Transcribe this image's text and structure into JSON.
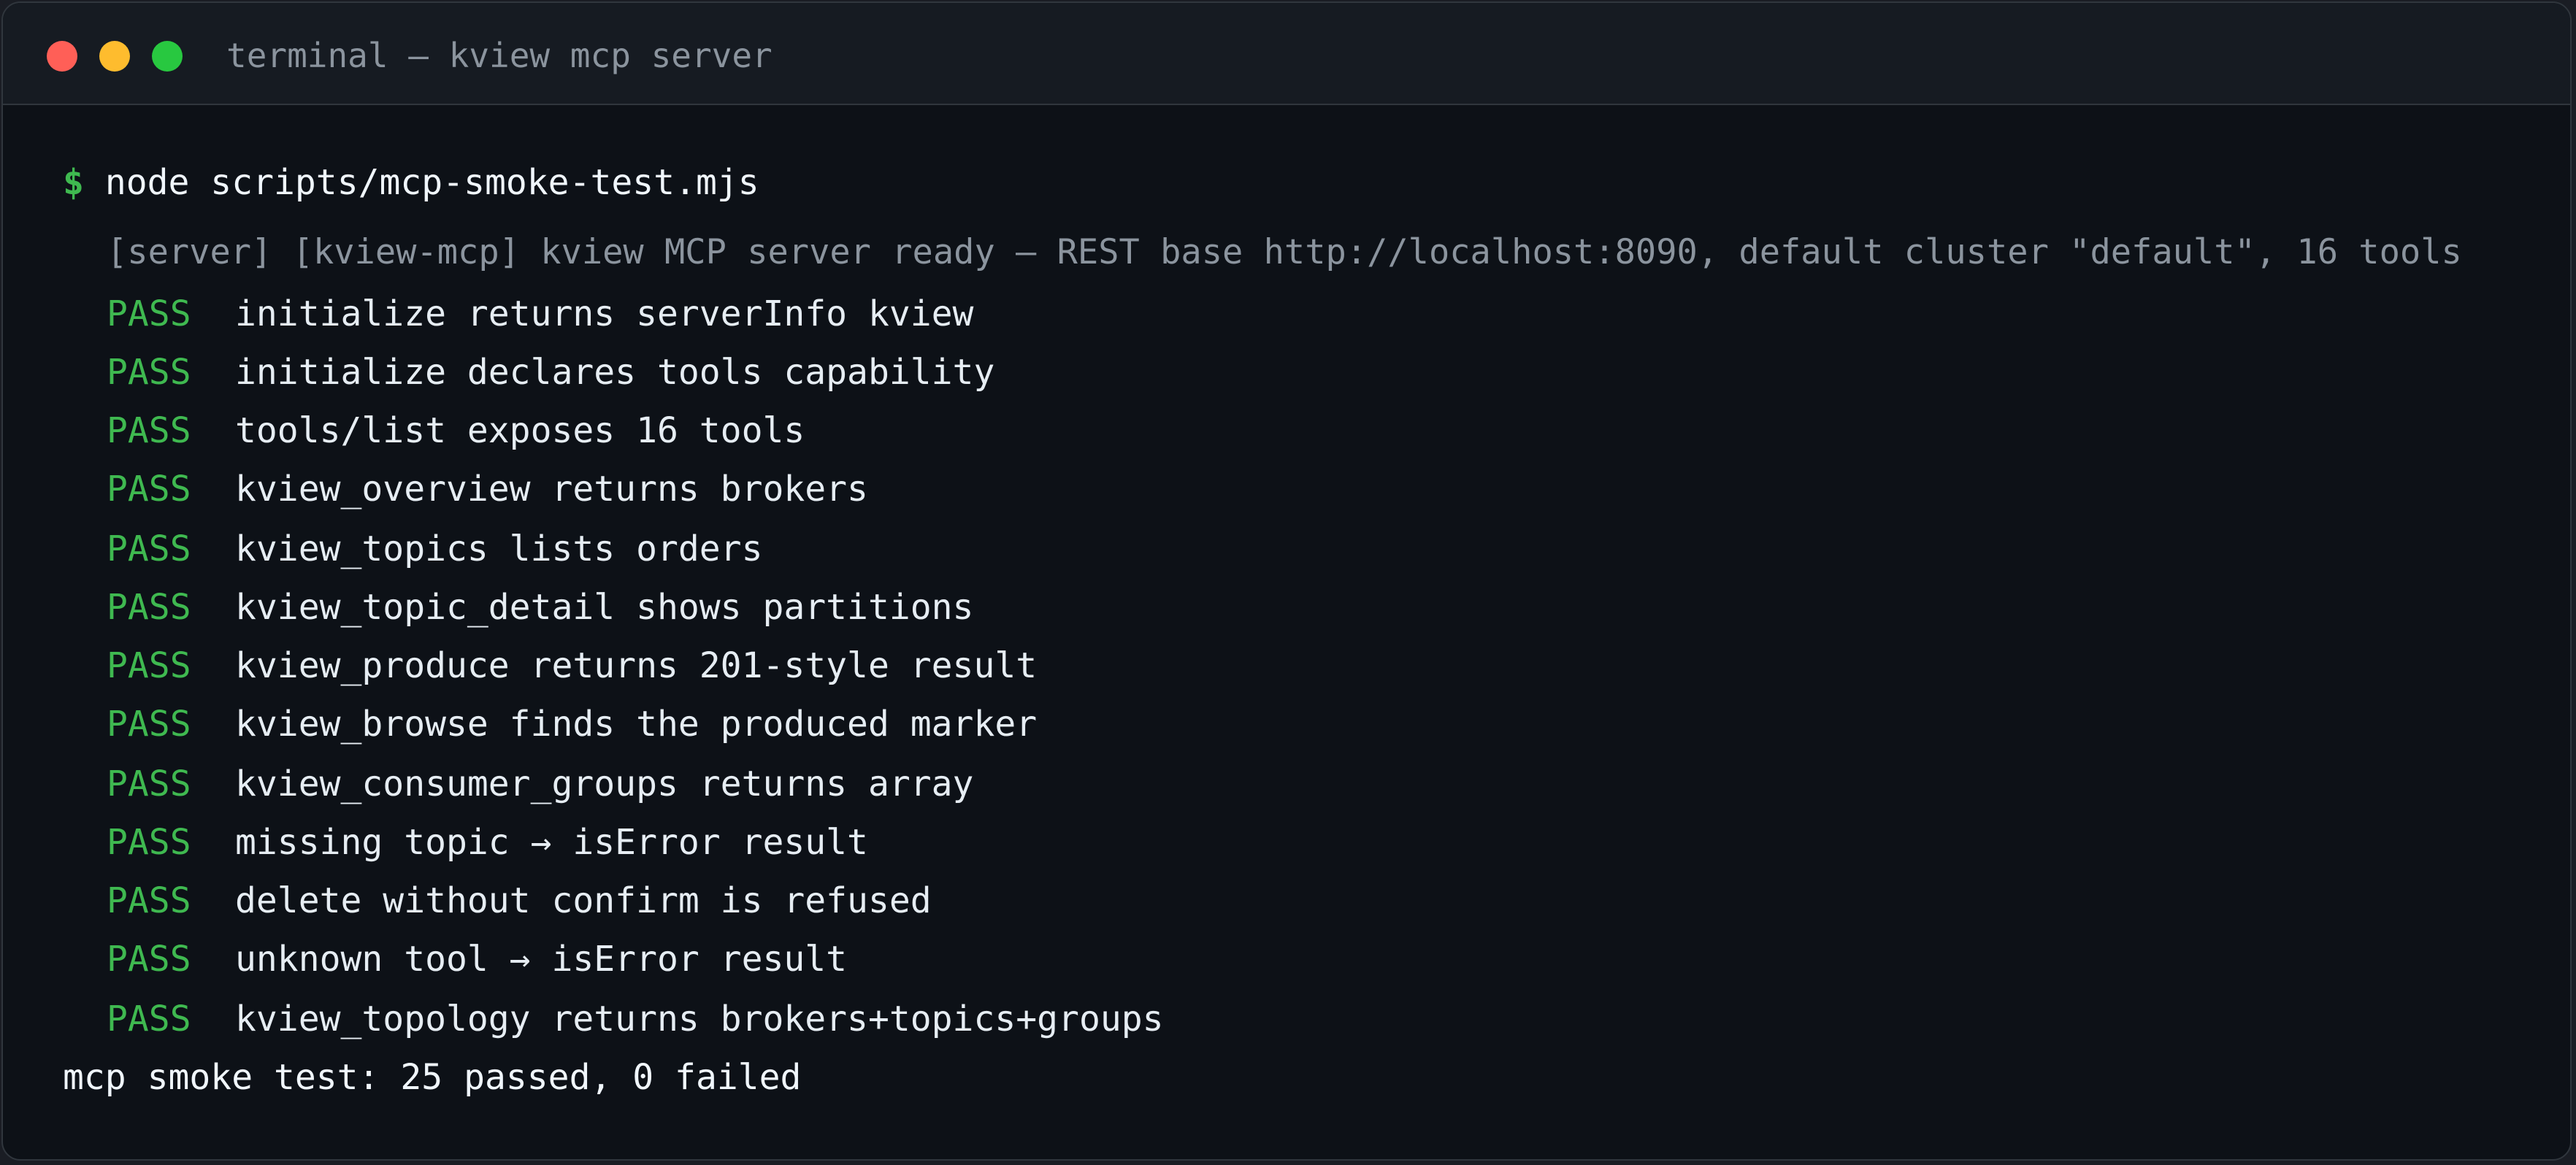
{
  "window": {
    "title": "terminal — kview mcp server",
    "traffic_lights": [
      "close",
      "minimize",
      "maximize"
    ]
  },
  "terminal": {
    "prompt_symbol": "$",
    "command": "node scripts/mcp-smoke-test.mjs",
    "server_log": "[server] [kview-mcp] kview MCP server ready — REST base http://localhost:8090, default cluster \"default\", 16 tools",
    "results": [
      {
        "status": "PASS",
        "text": "initialize returns serverInfo kview"
      },
      {
        "status": "PASS",
        "text": "initialize declares tools capability"
      },
      {
        "status": "PASS",
        "text": "tools/list exposes 16 tools"
      },
      {
        "status": "PASS",
        "text": "kview_overview returns brokers"
      },
      {
        "status": "PASS",
        "text": "kview_topics lists orders"
      },
      {
        "status": "PASS",
        "text": "kview_topic_detail shows partitions"
      },
      {
        "status": "PASS",
        "text": "kview_produce returns 201-style result"
      },
      {
        "status": "PASS",
        "text": "kview_browse finds the produced marker"
      },
      {
        "status": "PASS",
        "text": "kview_consumer_groups returns array"
      },
      {
        "status": "PASS",
        "text": "missing topic → isError result"
      },
      {
        "status": "PASS",
        "text": "delete without confirm is refused"
      },
      {
        "status": "PASS",
        "text": "unknown tool → isError result"
      },
      {
        "status": "PASS",
        "text": "kview_topology returns brokers+topics+groups"
      }
    ],
    "summary": "mcp smoke test: 25 passed, 0 failed"
  },
  "colors": {
    "background": "#0d1117",
    "pass": "#3fb950",
    "muted": "#8b949e",
    "text": "#e6edf3"
  }
}
